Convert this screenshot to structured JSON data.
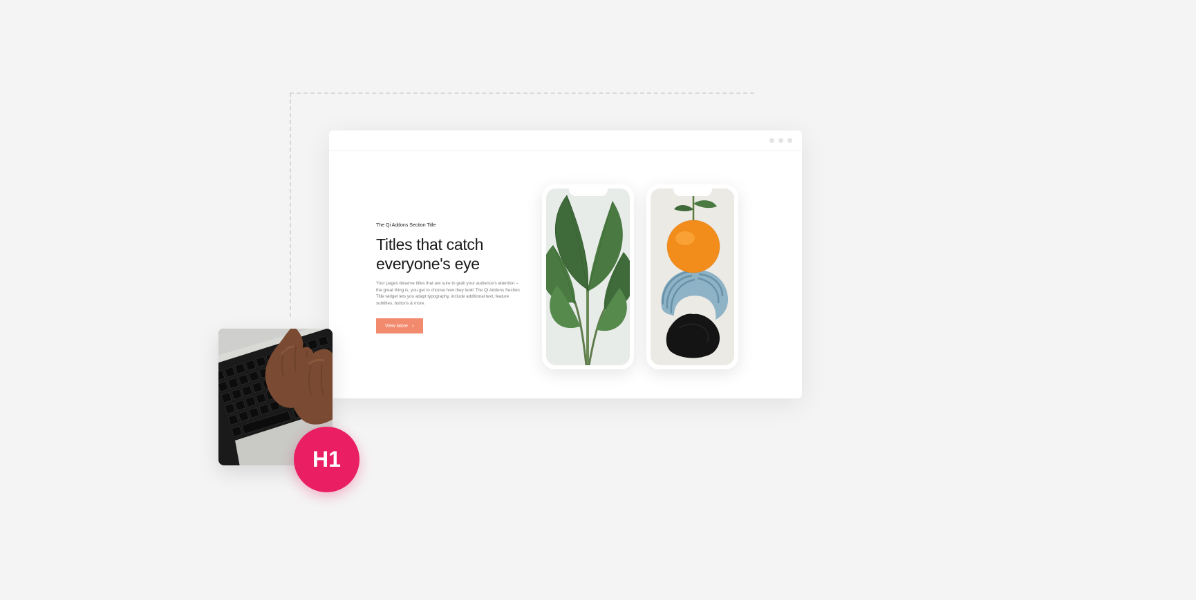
{
  "mockup": {
    "subtitle": "The Qi Addons Section Title",
    "title": "Titles that catch everyone's eye",
    "description": "Your pages deserve titles that are sure to grab your audience's attention – the great thing is, you get to choose how they look! The Qi Addons Section Title widget lets you adapt typography, include additional text, feature subtitles, buttons & more.",
    "button_label": "View More"
  },
  "badge": {
    "label": "H1"
  },
  "colors": {
    "background": "#f4f4f4",
    "accent_button": "#f28b6e",
    "badge": "#e91e63"
  }
}
